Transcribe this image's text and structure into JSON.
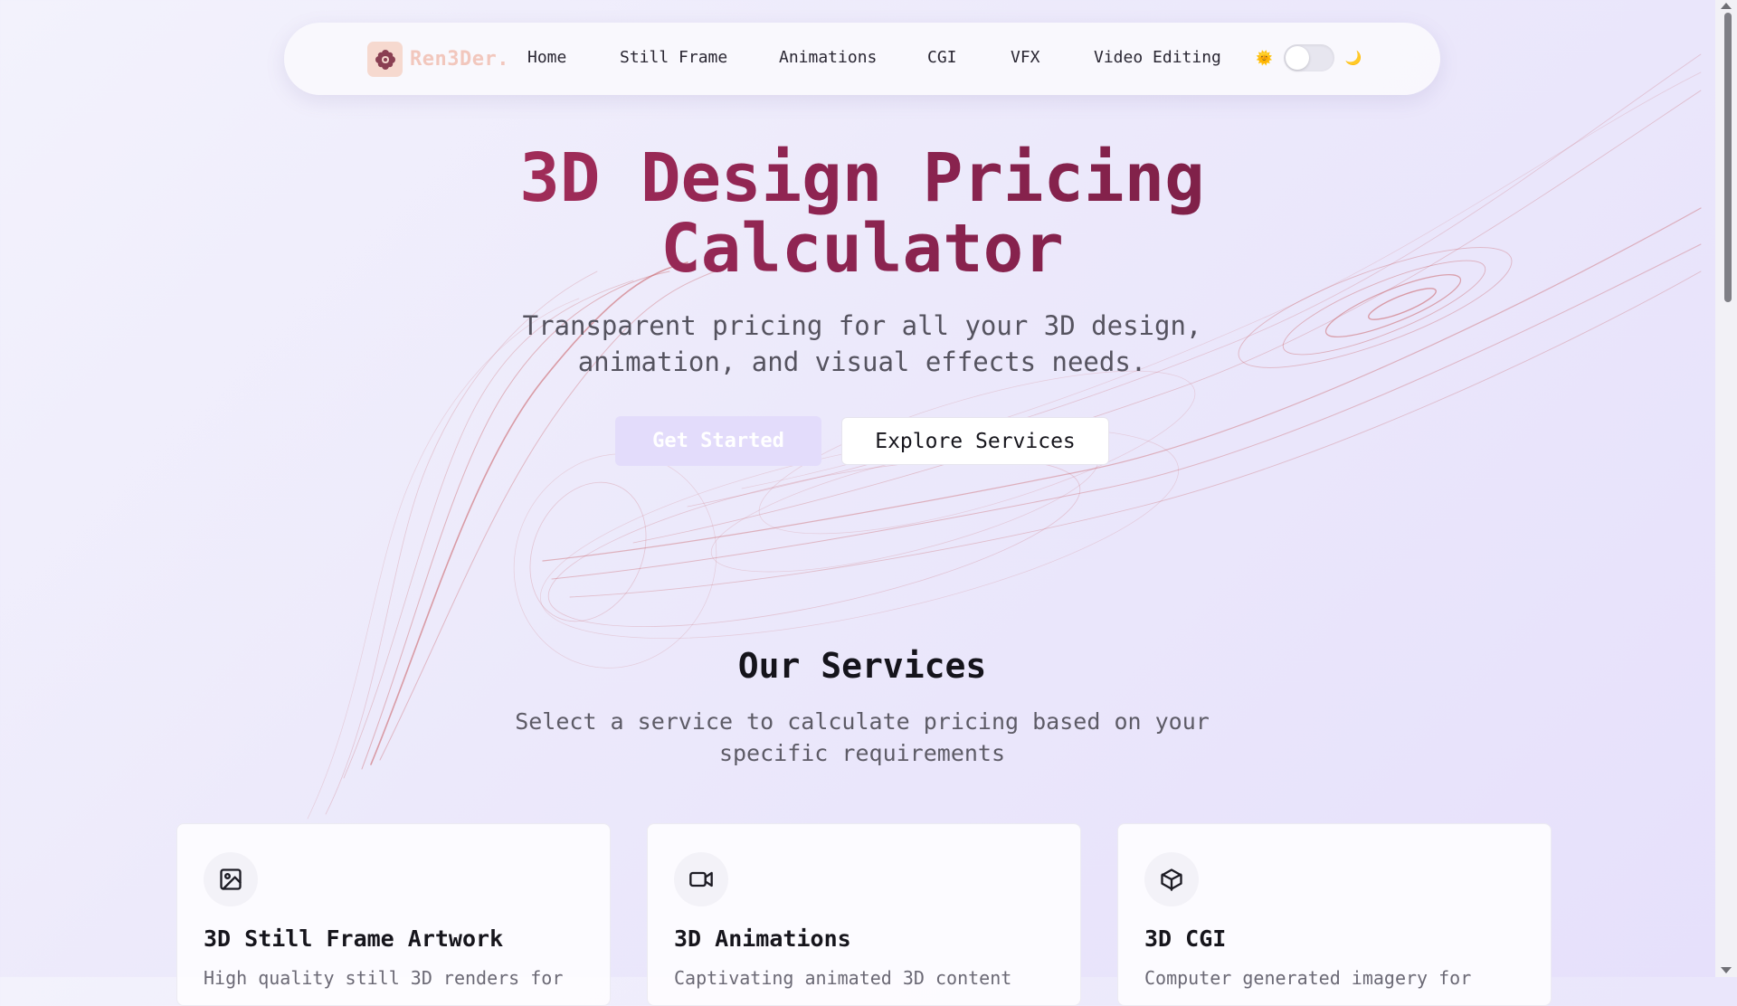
{
  "brand": {
    "name": "Ren3Der."
  },
  "nav": {
    "items": [
      "Home",
      "Still Frame",
      "Animations",
      "CGI",
      "VFX",
      "Video Editing"
    ],
    "theme": {
      "light_icon": "sun-emoji",
      "dark_icon": "moon-emoji",
      "sun": "🌞",
      "moon": "🌙",
      "enabled": false
    }
  },
  "hero": {
    "title_line1": "3D Design Pricing",
    "title_line2": "Calculator",
    "subtitle_line1": "Transparent pricing for all your 3D design,",
    "subtitle_line2": "animation, and visual effects needs.",
    "primary_button": "Get Started",
    "secondary_button": "Explore Services"
  },
  "services": {
    "title": "Our Services",
    "subtitle_line1": "Select a service to calculate pricing based on your",
    "subtitle_line2": "specific requirements",
    "cards": [
      {
        "icon": "image-icon",
        "title": "3D Still Frame Artwork",
        "desc": "High quality still 3D renders for"
      },
      {
        "icon": "video-camera-icon",
        "title": "3D Animations",
        "desc": "Captivating animated 3D content"
      },
      {
        "icon": "cube-icon",
        "title": "3D CGI",
        "desc": "Computer generated imagery for"
      }
    ]
  },
  "colors": {
    "title_start": "#c13a66",
    "title_end": "#6e1d3d",
    "primary_button_bg": "#e3dcfb",
    "swirl": "#c8595e"
  }
}
